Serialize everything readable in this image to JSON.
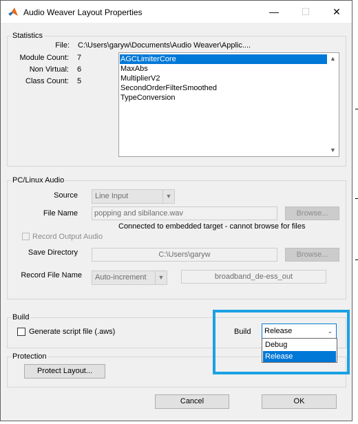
{
  "window": {
    "title": "Audio Weaver Layout Properties",
    "minimize": "—",
    "maximize": "☐",
    "close": "✕"
  },
  "statistics": {
    "group_title": "Statistics",
    "file_label": "File:",
    "file_value": "C:\\Users\\garyw\\Documents\\Audio Weaver\\Applic....",
    "module_count_label": "Module Count:",
    "module_count_value": "7",
    "non_virtual_label": "Non Virtual:",
    "non_virtual_value": "6",
    "class_count_label": "Class Count:",
    "class_count_value": "5",
    "classes": [
      "AGCLimiterCore",
      "MaxAbs",
      "MultiplierV2",
      "SecondOrderFilterSmoothed",
      "TypeConversion"
    ],
    "selected_index": 0
  },
  "pc_audio": {
    "group_title": "PC/Linux Audio",
    "source_label": "Source",
    "source_value": "Line Input",
    "file_name_label": "File Name",
    "file_name_value": "popping and sibilance.wav",
    "browse_label": "Browse...",
    "connected_message": "Connected to embedded target - cannot browse for files",
    "record_output_label": "Record Output Audio",
    "save_directory_label": "Save Directory",
    "save_directory_value": "C:\\Users\\garyw",
    "record_file_name_label": "Record File Name",
    "record_file_mode": "Auto-increment",
    "record_file_value": "broadband_de-ess_out"
  },
  "build": {
    "group_title": "Build",
    "generate_script_label": "Generate script file (.aws)",
    "build_label": "Build",
    "build_value": "Release",
    "options": [
      "Debug",
      "Release"
    ],
    "selected_option": "Release"
  },
  "protection": {
    "group_title": "Protection",
    "protect_layout_label": "Protect Layout..."
  },
  "footer": {
    "cancel_label": "Cancel",
    "ok_label": "OK"
  },
  "colors": {
    "selection": "#0078d7",
    "highlight_frame": "#1ba1e2",
    "window_bg": "#f0f0f0"
  }
}
